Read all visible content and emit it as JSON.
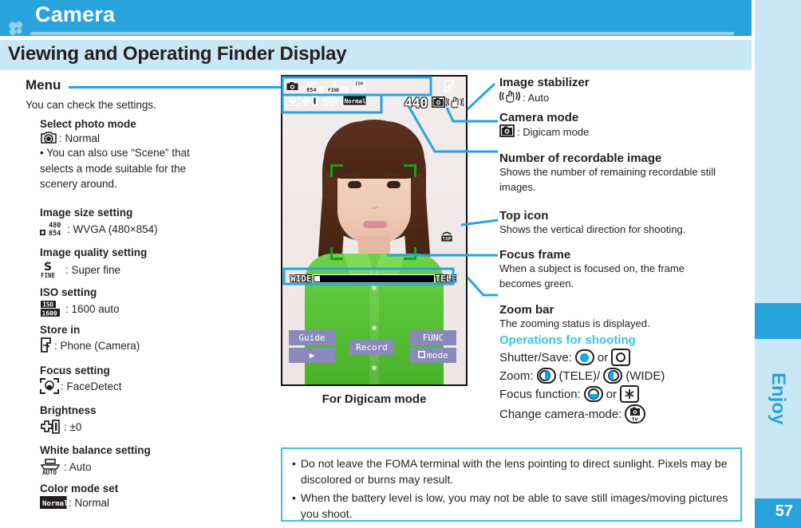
{
  "header": {
    "chapter": "Camera",
    "section_title": "Viewing and Operating Finder Display",
    "flower_icon": "clover-icon"
  },
  "sidebar": {
    "label": "Enjoy",
    "page_number": "57"
  },
  "left_column": {
    "menu_label": "Menu",
    "intro": "You can check the settings.",
    "items": [
      {
        "heading": "Select photo mode",
        "icon": "photo-mode-icon",
        "value": ": Normal",
        "note": "• You can also use “Scene” that selects a mode suitable for the scenery around."
      },
      {
        "heading": "Image size setting",
        "icon": "image-size-icon",
        "value": ": WVGA (480×854)",
        "icon_text_top": "480",
        "icon_text_bottom": "854"
      },
      {
        "heading": "Image quality setting",
        "icon": "image-quality-icon",
        "value": ": Super fine",
        "icon_text_top": "S",
        "icon_text_bottom": "FINE"
      },
      {
        "heading": "ISO setting",
        "icon": "iso-icon",
        "value": ": 1600 auto",
        "icon_text_top": "ISO",
        "icon_text_bottom": "1600"
      },
      {
        "heading": "Store in",
        "icon": "store-in-icon",
        "value": ": Phone (Camera)"
      },
      {
        "heading": "Focus setting",
        "icon": "face-detect-icon",
        "value": ": FaceDetect"
      },
      {
        "heading": "Brightness",
        "icon": "brightness-icon",
        "value": ": ±0"
      },
      {
        "heading": "White balance setting",
        "icon": "white-balance-icon",
        "value": ": Auto",
        "icon_text_bottom": "AUTO"
      },
      {
        "heading": "Color mode set",
        "icon": "color-mode-icon",
        "value": ": Normal",
        "icon_text_top": "Normal"
      }
    ]
  },
  "phone": {
    "caption": "For Digicam mode",
    "osd": {
      "camera_mode_icon": "camera-icon",
      "size_top": "480",
      "size_bottom": "854",
      "size_x": "×",
      "quality_top": "S",
      "quality_bottom": "FINE",
      "iso_top": "ISO",
      "iso_bottom": "1600",
      "store_icon": "store-in-icon",
      "focus_icon": "face-detect-icon",
      "brightness": "±0",
      "wb_label": "AUTO",
      "color_mode": "Normal",
      "recordable_count": "440",
      "camera_mode_badge_icon": "camera-icon",
      "stabilizer_icon": "hand-shake-icon",
      "top_icon_label": "TOP"
    },
    "zoom_bar": {
      "wide_label": "WIDE",
      "tele_label": "TELE"
    },
    "softkeys": {
      "guide": "Guide",
      "play": "▶",
      "record": "Record",
      "func": "FUNC",
      "mode": "mode",
      "mode_icon": "movie-icon"
    }
  },
  "right_column": {
    "items": [
      {
        "heading": "Image stabilizer",
        "icon": "hand-shake-icon",
        "value": ": Auto"
      },
      {
        "heading": "Camera mode",
        "icon": "camera-icon",
        "value": ": Digicam mode"
      },
      {
        "heading": "Number of recordable image",
        "body": "Shows the number of remaining recordable still images."
      },
      {
        "heading": "Top icon",
        "body": "Shows the vertical direction for shooting."
      },
      {
        "heading": "Focus frame",
        "body": "When a subject is focused on, the frame becomes green."
      },
      {
        "heading": "Zoom bar",
        "body": "The zooming status is displayed."
      }
    ],
    "operations": {
      "title": "Operations for shooting",
      "rows": [
        {
          "label": "Shutter/Save:",
          "mid": "or",
          "key1": "center-key-icon",
          "key2": "oval-key-icon"
        },
        {
          "label": "Zoom:",
          "key1": "nav-right-key-icon",
          "suffix1": "(TELE)/",
          "key2": "nav-left-key-icon",
          "suffix2": "(WIDE)"
        },
        {
          "label": "Focus function:",
          "mid": "or",
          "key1": "nav-down-key-icon",
          "key2": "asterisk-key-icon"
        },
        {
          "label": "Change camera-mode:",
          "key1": "tv-camera-key-icon"
        }
      ]
    }
  },
  "note_box": {
    "items": [
      "Do not leave the FOMA terminal with the lens pointing to direct sunlight. Pixels may be discolored or burns may result.",
      "When the battery level is low, you may not be able to save still images/moving pictures you shoot."
    ],
    "bullet": "•"
  },
  "colors": {
    "brand_blue": "#29A3DC",
    "light_blue": "#CAE7F5",
    "accent_cyan": "#3BC3DE",
    "key_blue": "#00AEEF",
    "focus_green": "#17A217"
  }
}
